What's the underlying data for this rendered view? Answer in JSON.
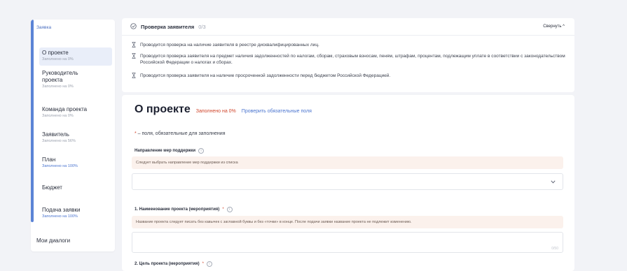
{
  "sidebar": {
    "group": "Заявка",
    "items": [
      {
        "title": "О проекте",
        "status": "Заполнено на 0%"
      },
      {
        "title": "Руководитель проекта",
        "status": "Заполнено на 0%"
      },
      {
        "title": "Команда проекта",
        "status": "Заполнено на 0%"
      },
      {
        "title": "Заявитель",
        "status": "Заполнено на 56%"
      },
      {
        "title": "План",
        "status": "Заполнено на 100%"
      },
      {
        "title": "Бюджет",
        "status": ""
      },
      {
        "title": "Подача заявки",
        "status": "Заполнено на 100%"
      }
    ],
    "dialogs": "Мои диалоги"
  },
  "check": {
    "title": "Проверка заявителя",
    "count": "0/3",
    "collapse": "Свернуть ^",
    "items": [
      "Проводится проверка на наличие заявителя в реестре дисквалифицированных лиц.",
      "Проводится проверка заявителя на предмет наличия задолженностей по налогам, сборам, страховым взносам, пеням, штрафам, процентам, подлежащим уплате в соответствии с законодательством Российской Федерации о налогах и сборах.",
      "Проводится проверка заявителя на наличие просроченной задолженности перед бюджетом Российской Федерацией."
    ]
  },
  "form": {
    "title": "О проекте",
    "filled": "Заполнено на 0%",
    "check_link": "Проверить обязательные поля",
    "required_star": "*",
    "required_note": " – поля, обязательные для заполнения",
    "direction": {
      "label": "Направление мер поддержки",
      "hint": "Следует выбрать направление мер поддержки из списка"
    },
    "name": {
      "label": "1. Наименование проекта (мероприятия)",
      "hint": "Название проекта следует писать без кавычек с заглавной буквы и без «точки» в конце. После подачи заявки название проекта не подлежит изменению.",
      "counter": "0/50"
    },
    "goal": {
      "label": "2. Цель проекта (мероприятия)"
    }
  },
  "colors": {
    "accent": "#4a74cf",
    "warning": "#d0462c",
    "hint_bg": "#fbf1ec"
  }
}
